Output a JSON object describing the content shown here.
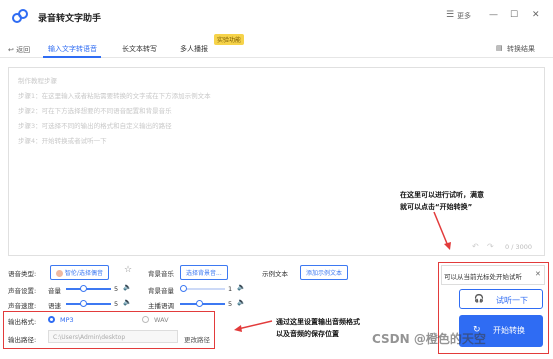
{
  "app": {
    "title": "录音转文字助手",
    "more": "更多",
    "minimize": "—",
    "maximize": "☐",
    "close": "✕"
  },
  "nav": {
    "back": "返回",
    "tabs": [
      {
        "label": "输入文字转语音"
      },
      {
        "label": "长文本转写"
      },
      {
        "label": "多人播报"
      }
    ],
    "badge": "实验功能",
    "result": "转换结果"
  },
  "editor": {
    "lines": [
      "制作教程步骤",
      "步骤1：在这里输入或者粘贴需要转换的文字或在下方添加示例文本",
      "步骤2：可在下方选择想要的不同语音配置和背景音乐",
      "步骤3：可选择不同的输出的格式和自定义输出的路径",
      "步骤4：开始转换或者试听一下"
    ],
    "counter": "0 / 3000",
    "undo": "↶",
    "redo": "↷"
  },
  "annotations": {
    "trial": [
      "在这里可以进行试听，满意",
      "就可以点击“开始转换”"
    ],
    "format": [
      "通过这里设置输出音频格式",
      "以及音频的保存位置"
    ]
  },
  "settings": {
    "voice_type_label": "语音类型:",
    "voice_button": "智伦/选择偶音",
    "bgm_label": "背景音乐",
    "bgm_button": "选择背景音...",
    "sample_label": "示例文本",
    "sample_button": "添加示例文本",
    "voice_settings_label": "声音设置:",
    "volume_label": "音量",
    "volume_value": "5",
    "bg_volume_label": "背景音量",
    "bg_volume_value": "1",
    "speed_settings_label": "声音速度:",
    "speed_label": "语速",
    "speed_value": "5",
    "pitch_label": "主播语调",
    "pitch_value": "5"
  },
  "output": {
    "format_label": "输出格式:",
    "format_mp3": "MP3",
    "format_wav": "WAV",
    "path_label": "输出路径:",
    "path_value": "C:\\Users\\Admin\\desktop",
    "change_path": "更改路径"
  },
  "side": {
    "popup_text": "可以从当前光标处开始试听",
    "popup_close": "✕",
    "trial_button": "试听一下",
    "start_button": "开始转换"
  },
  "watermark": "CSDN @橙色的天空",
  "colors": {
    "accent": "#2f6cf3",
    "highlight": "#e23b3b"
  }
}
